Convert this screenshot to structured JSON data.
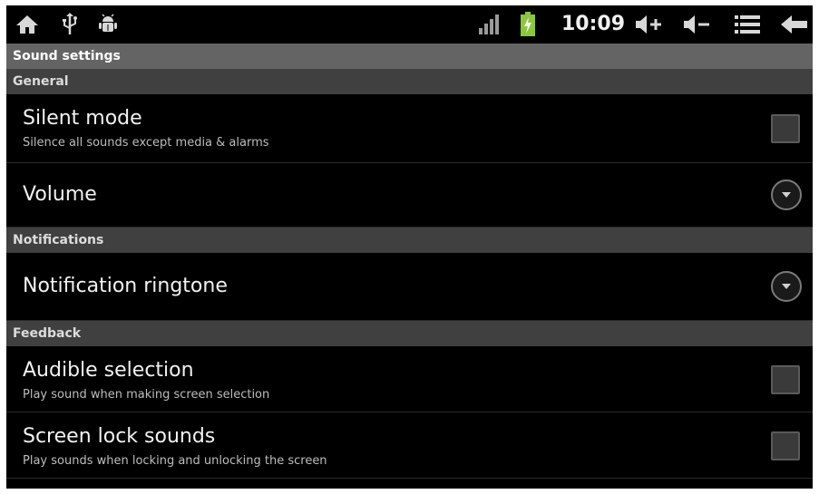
{
  "status_bar": {
    "time": "10:09",
    "icons_left": [
      "home-icon",
      "usb-icon",
      "android-debug-icon"
    ],
    "icons_right": [
      "signal-icon",
      "battery-charging-icon",
      "volume-up-icon",
      "volume-down-icon",
      "menu-icon",
      "back-icon"
    ]
  },
  "screen": {
    "title": "Sound settings"
  },
  "sections": {
    "general": "General",
    "notifications": "Notifications",
    "feedback": "Feedback"
  },
  "items": {
    "silent_mode": {
      "title": "Silent mode",
      "summary": "Silence all sounds except media & alarms",
      "checked": false
    },
    "volume": {
      "title": "Volume"
    },
    "notification_ringtone": {
      "title": "Notification ringtone"
    },
    "audible_selection": {
      "title": "Audible selection",
      "summary": "Play sound when making screen selection",
      "checked": false
    },
    "screen_lock_sounds": {
      "title": "Screen lock sounds",
      "summary": "Play sounds when locking and unlocking the screen",
      "checked": false
    }
  },
  "colors": {
    "background": "#000000",
    "title_bar": "#646464",
    "section_header": "#404040",
    "battery": "#8cc63f"
  }
}
